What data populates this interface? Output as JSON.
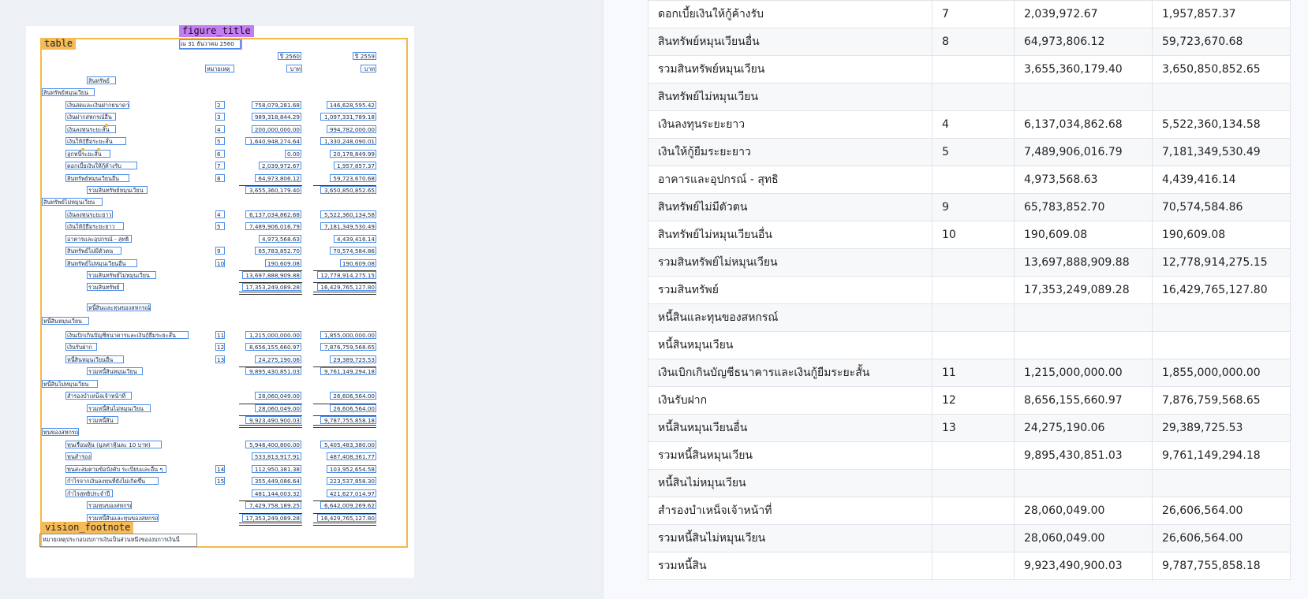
{
  "left": {
    "tags": {
      "table": "table",
      "figure_title": "figure_title",
      "vision_footnote": "vision_footnote"
    },
    "figure_title_text": "ณ 31 ธันวาคม 2560",
    "col_years": [
      "ปี 2560",
      "ปี 2559"
    ],
    "col_note_header": "หมายเหตุ",
    "col_units": [
      "บาท",
      "บาท"
    ],
    "rows": [
      {
        "label": "สินทรัพย์"
      },
      {
        "label": "สินทรัพย์หมุนเวียน"
      },
      {
        "label": "เงินสดและเงินฝากธนาคาร",
        "note": "2",
        "v1": "758,079,281.68",
        "v2": "146,628,595.42"
      },
      {
        "label": "เงินฝากสหกรณ์อื่น",
        "note": "3",
        "v1": "989,318,844.29",
        "v2": "1,097,331,789.18"
      },
      {
        "label": "เงินลงทุนระยะสั้น",
        "note": "4",
        "v1": "200,000,000.00",
        "v2": "994,782,000.00"
      },
      {
        "label": "เงินให้กู้ยืมระยะสั้น",
        "note": "5",
        "v1": "1,640,948,274.64",
        "v2": "1,330,248,090.01"
      },
      {
        "label": "ลูกหนี้ระยะสั้น",
        "note": "6",
        "v1": "0.00",
        "v2": "20,178,849.99"
      },
      {
        "label": "ดอกเบี้ยเงินให้กู้ค้างรับ",
        "note": "7",
        "v1": "2,039,972.67",
        "v2": "1,957,857.37"
      },
      {
        "label": "สินทรัพย์หมุนเวียนอื่น",
        "note": "8",
        "v1": "64,973,806.12",
        "v2": "59,723,670.68"
      },
      {
        "label": "รวมสินทรัพย์หมุนเวียน",
        "v1": "3,655,360,179.40",
        "v2": "3,650,850,852.65"
      },
      {
        "label": "สินทรัพย์ไม่หมุนเวียน"
      },
      {
        "label": "เงินลงทุนระยะยาว",
        "note": "4",
        "v1": "6,137,034,862.68",
        "v2": "5,522,360,134.58"
      },
      {
        "label": "เงินให้กู้ยืมระยะยาว",
        "note": "5",
        "v1": "7,489,906,016.79",
        "v2": "7,181,349,530.49"
      },
      {
        "label": "อาคารและอุปกรณ์ - สุทธิ",
        "v1": "4,973,568.63",
        "v2": "4,439,416.14"
      },
      {
        "label": "สินทรัพย์ไม่มีตัวตน",
        "note": "9",
        "v1": "65,783,852.70",
        "v2": "70,574,584.86"
      },
      {
        "label": "สินทรัพย์ไม่หมุนเวียนอื่น",
        "note": "10",
        "v1": "190,609.08",
        "v2": "190,609.08"
      },
      {
        "label": "รวมสินทรัพย์ไม่หมุนเวียน",
        "v1": "13,697,888,909.88",
        "v2": "12,778,914,275.15"
      },
      {
        "label": "รวมสินทรัพย์",
        "v1": "17,353,249,089.28",
        "v2": "16,429,765,127.80"
      },
      {
        "label": "หนี้สินและทุนของสหกรณ์"
      },
      {
        "label": "หนี้สินหมุนเวียน"
      },
      {
        "label": "เงินเบิกเกินบัญชีธนาคารและเงินกู้ยืมระยะสั้น",
        "note": "11",
        "v1": "1,215,000,000.00",
        "v2": "1,855,000,000.00"
      },
      {
        "label": "เงินรับฝาก",
        "note": "12",
        "v1": "8,656,155,660.97",
        "v2": "7,876,759,568.65"
      },
      {
        "label": "หนี้สินหมุนเวียนอื่น",
        "note": "13",
        "v1": "24,275,190.06",
        "v2": "29,389,725.53"
      },
      {
        "label": "รวมหนี้สินหมุนเวียน",
        "v1": "9,895,430,851.03",
        "v2": "9,761,149,294.18"
      },
      {
        "label": "หนี้สินไม่หมุนเวียน"
      },
      {
        "label": "สำรองบำเหน็จเจ้าหน้าที่",
        "v1": "28,060,049.00",
        "v2": "26,606,564.00"
      },
      {
        "label": "รวมหนี้สินไม่หมุนเวียน",
        "v1": "28,060,049.00",
        "v2": "26,606,564.00"
      },
      {
        "label": "รวมหนี้สิน",
        "v1": "9,923,490,900.03",
        "v2": "9,787,755,858.18"
      },
      {
        "label": "ทุนของสหกรณ์"
      },
      {
        "label": "ทุนเรือนหุ้น (มูลค่าหุ้นละ 10 บาท)",
        "v1": "5,946,400,800.00",
        "v2": "5,405,483,380.00"
      },
      {
        "label": "ทุนสำรอง",
        "v1": "533,813,917.91",
        "v2": "487,408,361.77"
      },
      {
        "label": "ทุนสะสมตามข้อบังคับ ระเบียบและอื่น ๆ",
        "note": "14",
        "v1": "112,950,381.38",
        "v2": "103,952,654.58"
      },
      {
        "label": "กำไรจากเงินลงทุนที่ยังไม่เกิดขึ้น",
        "note": "15",
        "v1": "355,449,086.64",
        "v2": "223,537,858.30"
      },
      {
        "label": "กำไรสุทธิประจำปี",
        "v1": "481,144,003.32",
        "v2": "421,627,014.97"
      },
      {
        "label": "รวมทุนของสหกรณ์",
        "v1": "7,429,758,189.25",
        "v2": "6,642,009,269.62"
      },
      {
        "label": "รวมหนี้สินและทุนของสหกรณ์",
        "v1": "17,353,249,089.28",
        "v2": "16,429,765,127.80"
      }
    ],
    "footnote_text": "หมายเหตุประกอบงบการเงินเป็นส่วนหนึ่งของงบการเงินนี้"
  },
  "right": {
    "rows": [
      [
        "ดอกเบี้ยเงินให้กู้ค้างรับ",
        "7",
        "2,039,972.67",
        "1,957,857.37"
      ],
      [
        "สินทรัพย์หมุนเวียนอื่น",
        "8",
        "64,973,806.12",
        "59,723,670.68"
      ],
      [
        "รวมสินทรัพย์หมุนเวียน",
        "",
        "3,655,360,179.40",
        "3,650,850,852.65"
      ],
      [
        "สินทรัพย์ไม่หมุนเวียน",
        "",
        "",
        ""
      ],
      [
        "เงินลงทุนระยะยาว",
        "4",
        "6,137,034,862.68",
        "5,522,360,134.58"
      ],
      [
        "เงินให้กู้ยืมระยะยาว",
        "5",
        "7,489,906,016.79",
        "7,181,349,530.49"
      ],
      [
        "อาคารและอุปกรณ์ - สุทธิ",
        "",
        "4,973,568.63",
        "4,439,416.14"
      ],
      [
        "สินทรัพย์ไม่มีตัวตน",
        "9",
        "65,783,852.70",
        "70,574,584.86"
      ],
      [
        "สินทรัพย์ไม่หมุนเวียนอื่น",
        "10",
        "190,609.08",
        "190,609.08"
      ],
      [
        "รวมสินทรัพย์ไม่หมุนเวียน",
        "",
        "13,697,888,909.88",
        "12,778,914,275.15"
      ],
      [
        "รวมสินทรัพย์",
        "",
        "17,353,249,089.28",
        "16,429,765,127.80"
      ],
      [
        "หนี้สินและทุนของสหกรณ์",
        "",
        "",
        ""
      ],
      [
        "หนี้สินหมุนเวียน",
        "",
        "",
        ""
      ],
      [
        "เงินเบิกเกินบัญชีธนาคารและเงินกู้ยืมระยะสั้น",
        "11",
        "1,215,000,000.00",
        "1,855,000,000.00"
      ],
      [
        "เงินรับฝาก",
        "12",
        "8,656,155,660.97",
        "7,876,759,568.65"
      ],
      [
        "หนี้สินหมุนเวียนอื่น",
        "13",
        "24,275,190.06",
        "29,389,725.53"
      ],
      [
        "รวมหนี้สินหมุนเวียน",
        "",
        "9,895,430,851.03",
        "9,761,149,294.18"
      ],
      [
        "หนี้สินไม่หมุนเวียน",
        "",
        "",
        ""
      ],
      [
        "สำรองบำเหน็จเจ้าหน้าที่",
        "",
        "28,060,049.00",
        "26,606,564.00"
      ],
      [
        "รวมหนี้สินไม่หมุนเวียน",
        "",
        "28,060,049.00",
        "26,606,564.00"
      ],
      [
        "รวมหนี้สิน",
        "",
        "9,923,490,900.03",
        "9,787,755,858.18"
      ]
    ]
  }
}
